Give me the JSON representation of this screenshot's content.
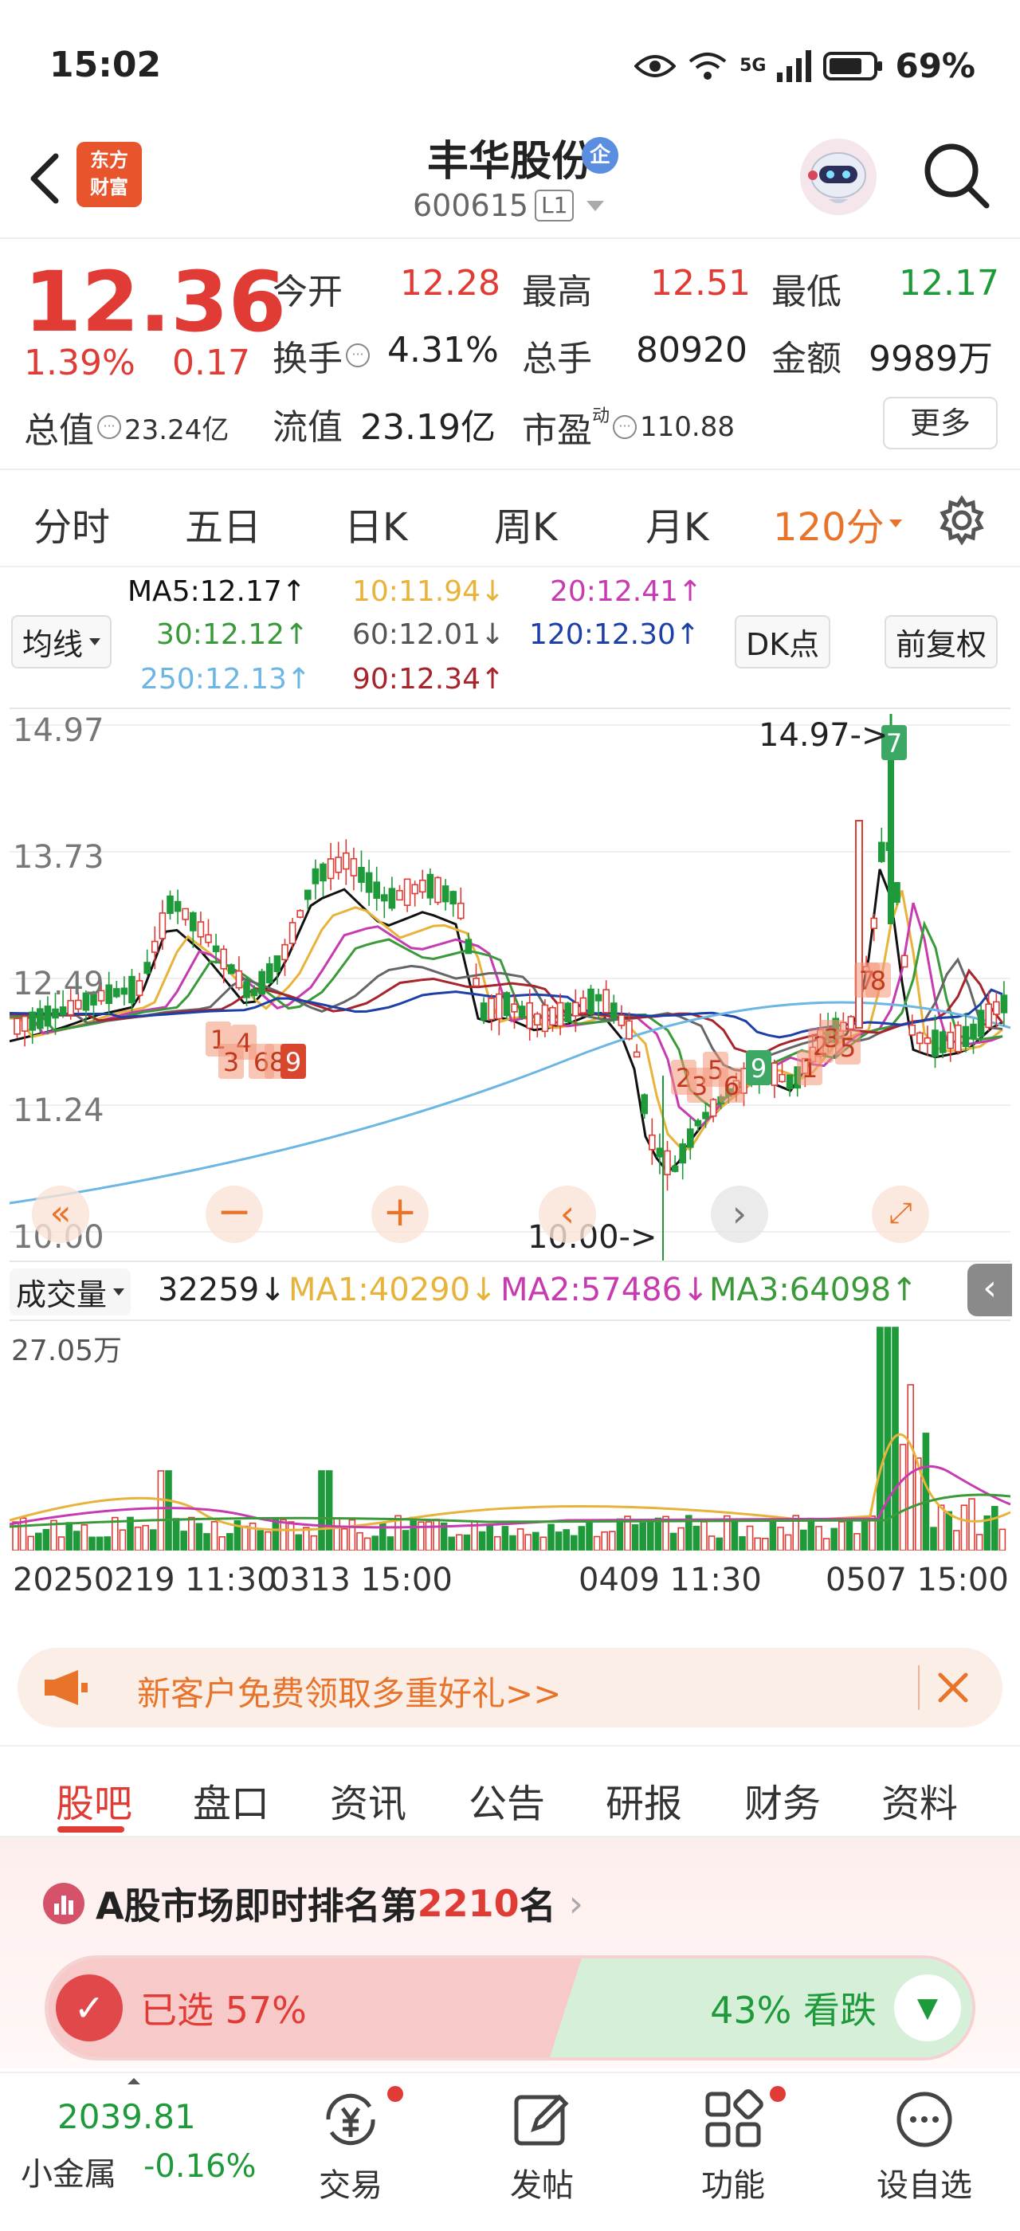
{
  "status": {
    "time": "15:02",
    "battery": "69%",
    "network": "5G"
  },
  "header": {
    "logo_line1": "东方",
    "logo_line2": "财富",
    "stock_name": "丰华股份",
    "ent_badge": "企",
    "code": "600615",
    "level": "L1"
  },
  "quote": {
    "price": "12.36",
    "change_pct": "1.39%",
    "change_amt": "0.17",
    "open_label": "今开",
    "open": "12.28",
    "high_label": "最高",
    "high": "12.51",
    "low_label": "最低",
    "low": "12.17",
    "turnover_label": "换手",
    "turnover": "4.31%",
    "volume_label": "总手",
    "volume": "80920",
    "amount_label": "金额",
    "amount": "9989万",
    "mktcap_label": "总值",
    "mktcap": "23.24亿",
    "float_label": "流值",
    "float": "23.19亿",
    "pe_label": "市盈",
    "pe_sup": "动",
    "pe": "110.88",
    "more": "更多"
  },
  "periods": [
    "分时",
    "五日",
    "日K",
    "周K",
    "月K",
    "120分"
  ],
  "ma_legend": {
    "ma_btn": "均线",
    "ma5": "MA5:12.17↑",
    "ma10": "10:11.94↓",
    "ma20": "20:12.41↑",
    "ma30": "30:12.12↑",
    "ma60": "60:12.01↓",
    "ma120": "120:12.30↑",
    "ma250": "250:12.13↑",
    "ma90": "90:12.34↑",
    "dk_btn": "DK点",
    "adjust_btn": "前复权"
  },
  "colors": {
    "up": "#e03b35",
    "down": "#1f9a3a",
    "accent": "#e8742b",
    "ma5": "#111111",
    "ma10": "#e8b33a",
    "ma20": "#c73bb0",
    "ma30": "#3a9a3a",
    "ma60": "#666666",
    "ma120": "#1c3fa8",
    "ma250": "#6cb6e4",
    "ma90": "#a6242b"
  },
  "kline": {
    "y_ticks": [
      "14.97",
      "13.73",
      "12.49",
      "11.24",
      "10.00"
    ],
    "high_marker": "14.97->",
    "low_marker": "10.00->",
    "signals": [
      {
        "label": "1",
        "kind": "buy"
      },
      {
        "label": "4",
        "kind": "buy"
      },
      {
        "label": "3",
        "kind": "buy"
      },
      {
        "label": "6",
        "kind": "buy"
      },
      {
        "label": "8",
        "kind": "buy"
      },
      {
        "label": "9",
        "kind": "sell"
      },
      {
        "label": "2",
        "kind": "buy"
      },
      {
        "label": "3",
        "kind": "buy"
      },
      {
        "label": "5",
        "kind": "buy"
      },
      {
        "label": "6",
        "kind": "buy"
      },
      {
        "label": "9",
        "kind": "green"
      },
      {
        "label": "1",
        "kind": "buy"
      },
      {
        "label": "2",
        "kind": "buy"
      },
      {
        "label": "3",
        "kind": "buy"
      },
      {
        "label": "5",
        "kind": "buy"
      },
      {
        "label": "7",
        "kind": "buy"
      },
      {
        "label": "8",
        "kind": "buy"
      },
      {
        "label": "7",
        "kind": "green"
      }
    ]
  },
  "volume": {
    "btn": "成交量",
    "current": "32259↓",
    "ma1": "MA1:40290↓",
    "ma2": "MA2:57486↓",
    "ma3": "MA3:64098↑",
    "y_top": "27.05万"
  },
  "dates": {
    "d1": "20250219 11:30",
    "d2": "0313 15:00",
    "d3": "0409 11:30",
    "d4": "0507 15:00"
  },
  "promo": {
    "text": "新客户免费领取多重好礼>>"
  },
  "info_tabs": [
    "股吧",
    "盘口",
    "资讯",
    "公告",
    "研报",
    "财务",
    "资料"
  ],
  "ranking": {
    "prefix": "A股市场即时排名第",
    "rank": "2210",
    "suffix": "名",
    "up_text": "已选 57%",
    "down_text": "43% 看跌"
  },
  "bottom": {
    "index_value": "2039.81",
    "index_name": "小金属",
    "index_change": "-0.16%",
    "trade": "交易",
    "post": "发帖",
    "func": "功能",
    "watch": "设自选"
  }
}
